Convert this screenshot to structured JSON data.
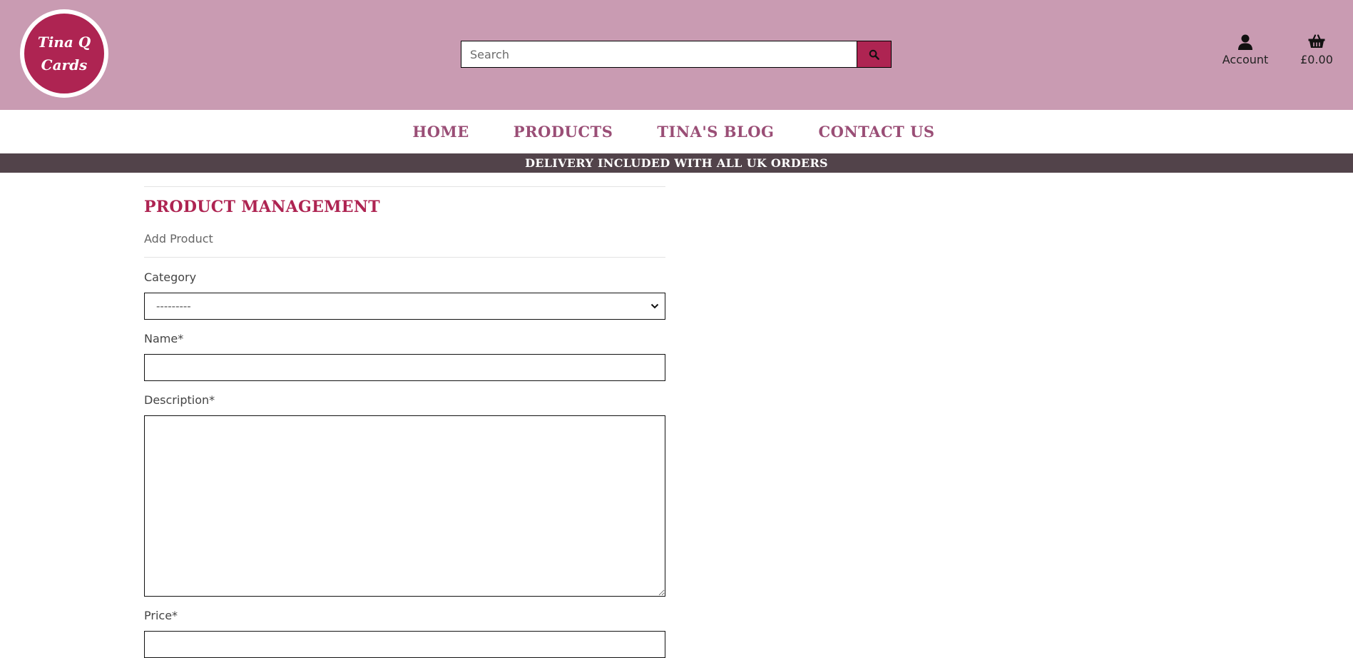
{
  "header": {
    "logo_line1": "Tina Q",
    "logo_line2": "Cards",
    "search_placeholder": "Search",
    "account_label": "Account",
    "cart_total": "£0.00"
  },
  "nav": {
    "items": [
      "HOME",
      "PRODUCTS",
      "TINA'S BLOG",
      "CONTACT US"
    ]
  },
  "banner": "DELIVERY INCLUDED WITH ALL UK ORDERS",
  "main": {
    "title": "PRODUCT MANAGEMENT",
    "subtitle": "Add Product",
    "form": {
      "category_label": "Category",
      "category_selected": "---------",
      "name_label": "Name*",
      "description_label": "Description*",
      "price_label": "Price*"
    }
  },
  "colors": {
    "header_bg": "#c99bb2",
    "brand": "#ae2452",
    "nav_link": "#9a4e76",
    "banner_bg": "#52434a"
  },
  "icons": [
    "search-icon",
    "user-icon",
    "basket-icon",
    "chevron-down-icon"
  ]
}
